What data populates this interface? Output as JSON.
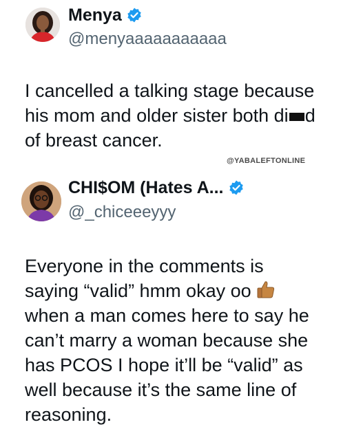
{
  "tweets": [
    {
      "display_name": "Menya",
      "handle": "@menyaaaaaaaaaaa",
      "avatar_icon": "avatar-woman-red-top",
      "verified_icon": "verified-badge-icon",
      "verified_color": "#1d9bf0",
      "text_lines": [
        "I cancelled a talking stage because",
        "his mom and older sister both di",
        "d",
        "of breast cancer."
      ]
    },
    {
      "display_name": "CHI$OM (Hates A...",
      "handle": "@_chiceeeyyy",
      "avatar_icon": "avatar-woman-glasses",
      "verified_icon": "verified-badge-icon",
      "verified_color": "#1d9bf0",
      "text_lines": [
        "Everyone in the comments is",
        "saying “valid” hmm okay oo",
        "when a man comes here to say he",
        "can’t marry a woman because she",
        "has PCOS I hope it’ll be “valid” as",
        "well because it’s the same line of",
        "reasoning."
      ],
      "emoji_icon": "thumbs-up-icon"
    }
  ],
  "watermark": "@YABALEFTONLINE"
}
